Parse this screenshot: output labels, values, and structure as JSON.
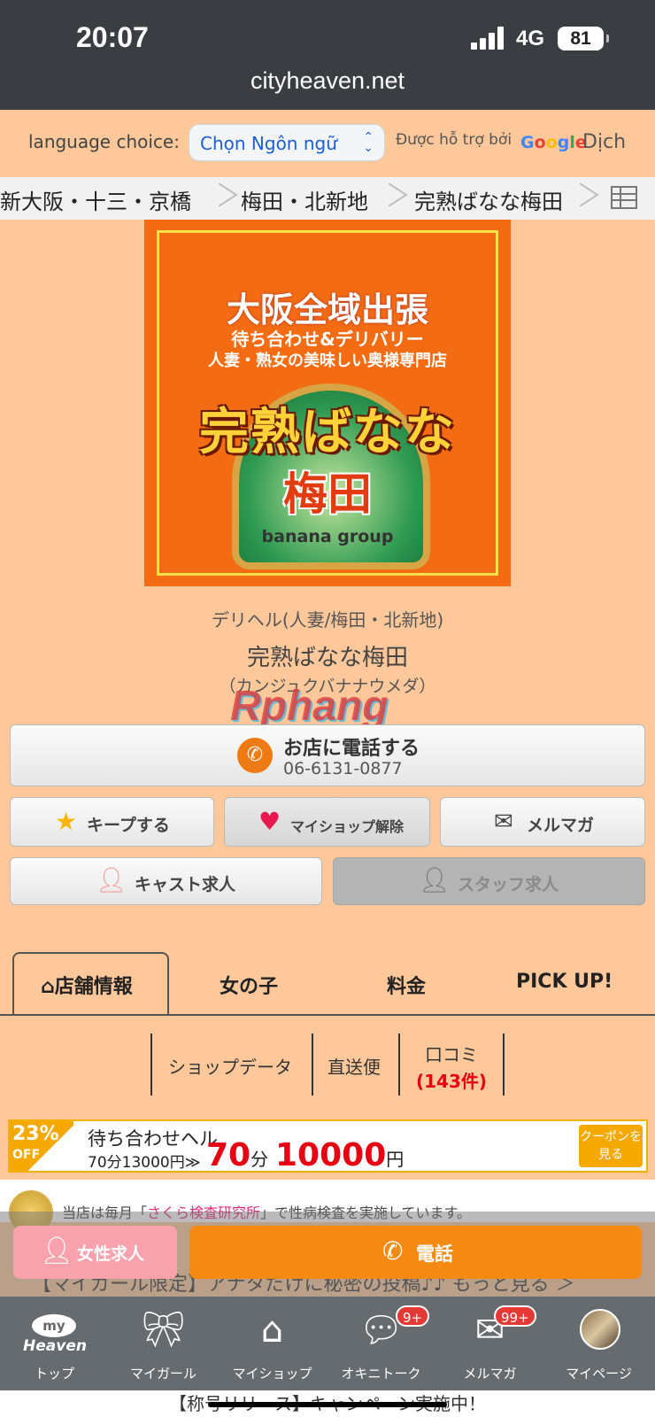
{
  "status_bar": {
    "time": "20:07",
    "network": "4G",
    "battery": "81"
  },
  "browser": {
    "url": "cityheaven.net"
  },
  "language": {
    "label": "language choice:",
    "select_value": "Chọn Ngôn ngữ",
    "powered_by": "Được hỗ trợ bởi",
    "google": "Google",
    "translate": "Dịch"
  },
  "breadcrumb": [
    "新大阪・十三・京橋",
    "梅田・北新地",
    "完熟ばなな梅田"
  ],
  "banner": {
    "line1": "大阪全域出張",
    "line2": "待ち合わせ&デリバリー",
    "line3": "人妻・熟女の美味しい奥様専門店",
    "name": "完熟ばなな",
    "city": "梅田",
    "group": "banana group"
  },
  "shop": {
    "category": "デリヘル(人妻/梅田・北新地)",
    "name": "完熟ばなな梅田",
    "kana": "（カンジュクバナナウメダ）",
    "watermark": "Rphang"
  },
  "call": {
    "label": "お店に電話する",
    "number": "06-6131-0877"
  },
  "actions": {
    "keep": "キープする",
    "myshop": "マイショップ解除",
    "mailmag": "メルマガ",
    "cast": "キャスト求人",
    "staff": "スタッフ求人"
  },
  "tabs": [
    "店舗情報",
    "女の子",
    "料金",
    "PICK UP!"
  ],
  "sub_nav": {
    "shopdata": "ショップデータ",
    "direct": "直送便",
    "reviews": "口コミ",
    "reviews_count": "(143件)"
  },
  "coupon": {
    "percent": "23%",
    "off": "OFF",
    "title": "待ち合わせヘル",
    "old": "70分13000円≫",
    "minutes": "70",
    "minutes_unit": "分",
    "price": "10000",
    "price_unit": "円",
    "button": "クーポンを見る"
  },
  "notice": {
    "before": "当店は毎月「",
    "link": "さくら検査研究所",
    "after": "」で性病検査を実施しています。"
  },
  "bottom_actions": {
    "female": "女性求人",
    "call": "電話"
  },
  "behind_text": "【マイガール限定】アナタだけに秘密の投稿♪♪ もっと見る ＞",
  "bottom_nav": [
    {
      "label": "トップ",
      "icon": "my-heaven-logo"
    },
    {
      "label": "マイガール",
      "icon": "ribbon-icon"
    },
    {
      "label": "マイショップ",
      "icon": "shop-icon"
    },
    {
      "label": "オキニトーク",
      "icon": "chat-icon",
      "badge": "9+"
    },
    {
      "label": "メルマガ",
      "icon": "mail-icon",
      "badge": "99+"
    },
    {
      "label": "マイページ",
      "icon": "avatar"
    }
  ],
  "my_heaven": {
    "my": "my",
    "heaven": "Heaven"
  },
  "footer": "【称号リリース】キャンペーン実施中！"
}
